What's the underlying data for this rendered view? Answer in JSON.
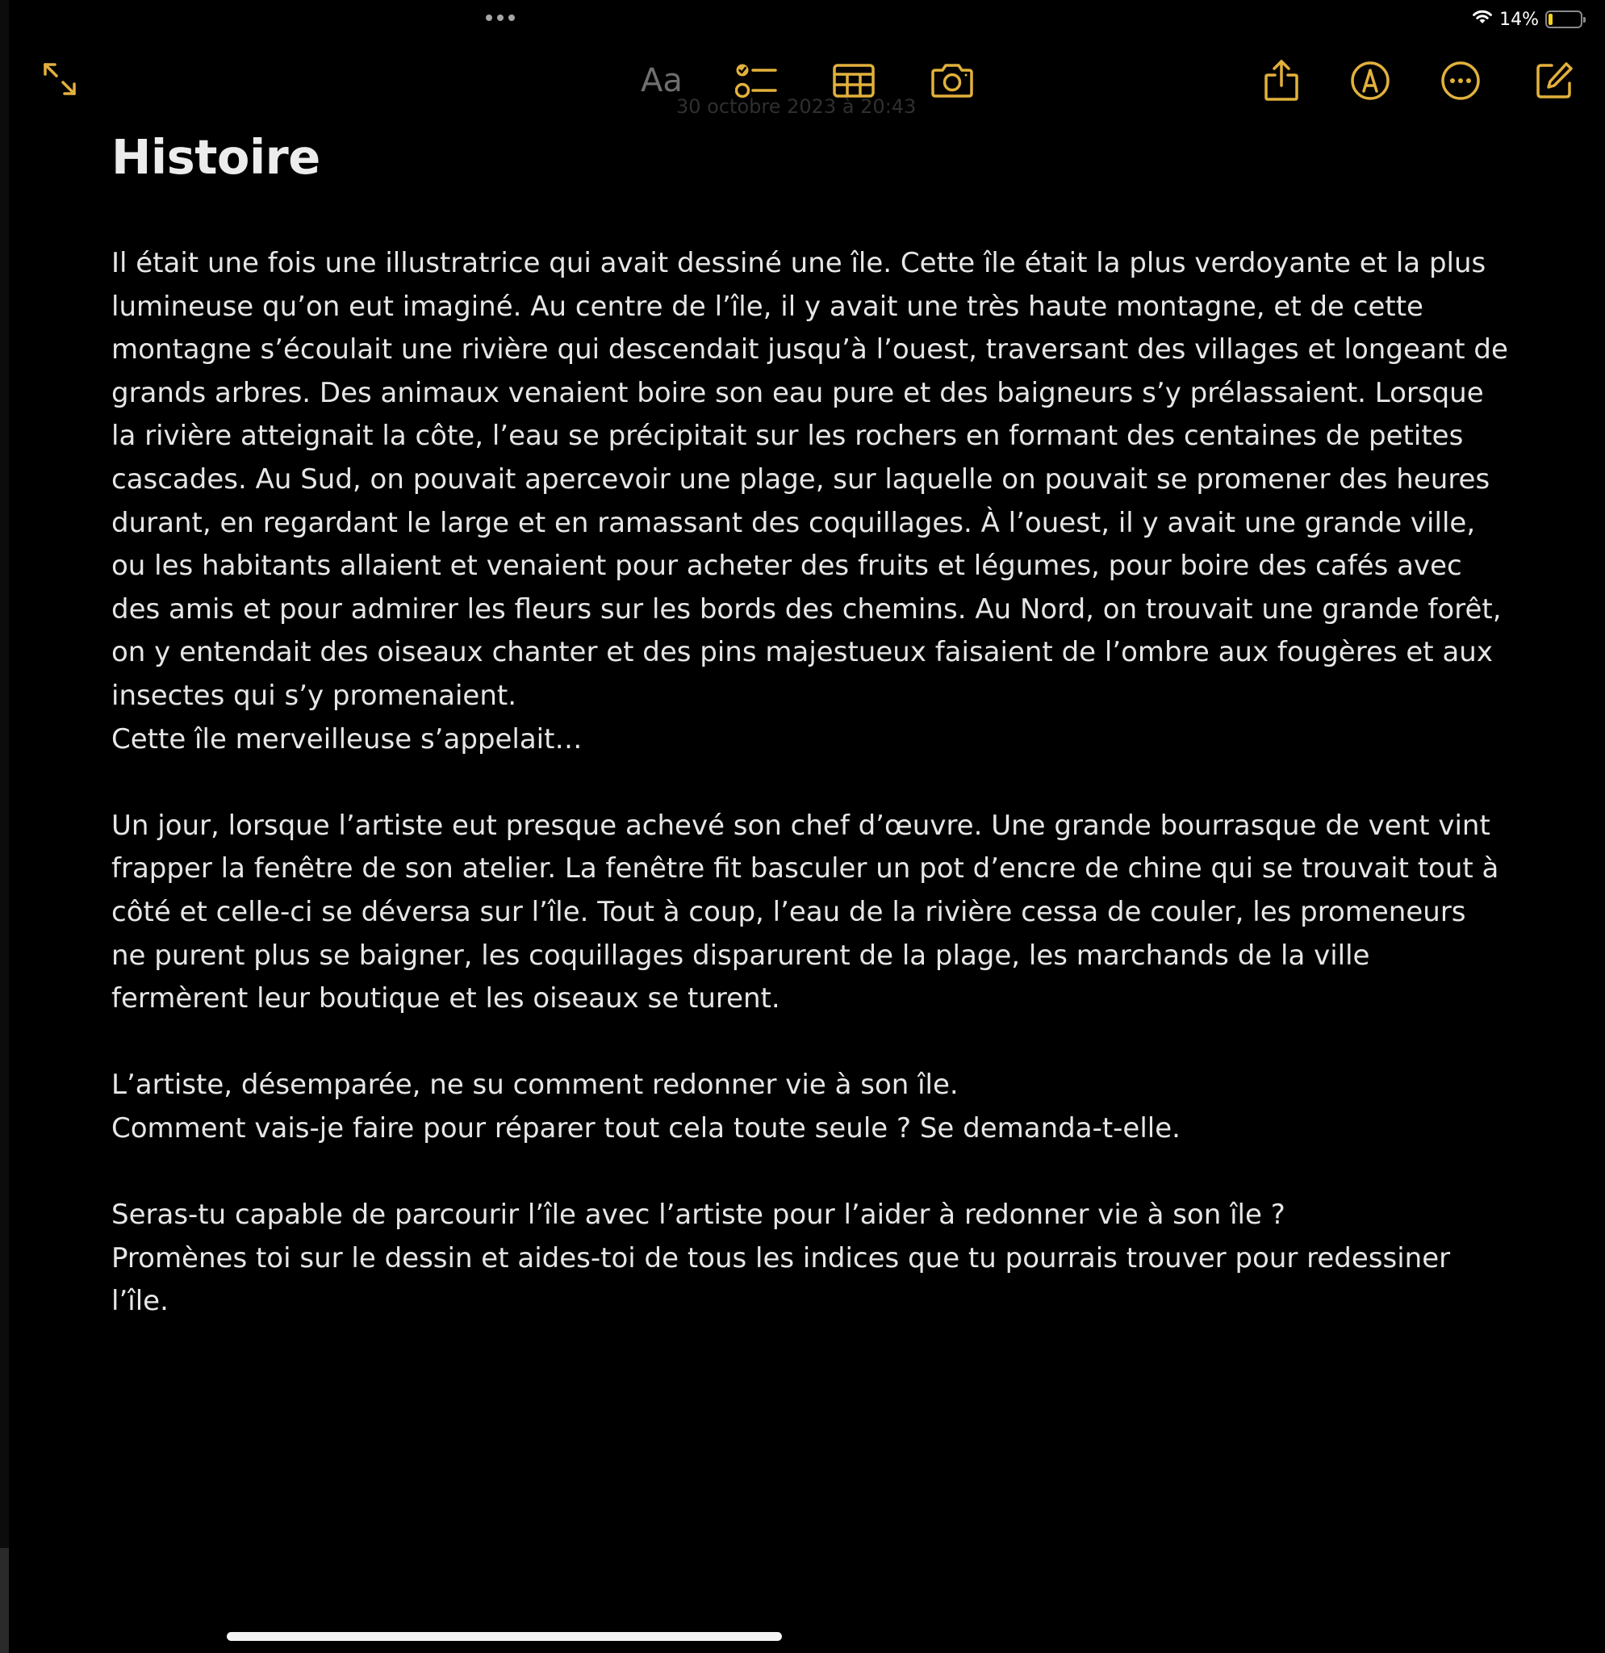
{
  "status_bar": {
    "battery_text": "14%",
    "battery_level": 0.14
  },
  "toolbar": {
    "format_label": "Aa",
    "date_text": "30 octobre 2023 à 20:43"
  },
  "note": {
    "title": "Histoire",
    "lines": [
      "Il était une fois une illustratrice qui avait dessiné une île. Cette île était la plus verdoyante et la plus",
      "lumineuse qu’on eut imaginé. Au centre de l’île, il y avait une très haute montagne, et de cette",
      "montagne s’écoulait une rivière qui descendait jusqu’à l’ouest, traversant des villages et longeant de",
      "grands arbres. Des animaux venaient boire son eau pure et des baigneurs s’y prélassaient. Lorsque",
      "la rivière atteignait la côte, l’eau se précipitait sur les rochers en formant des centaines de petites",
      "cascades. Au Sud, on pouvait apercevoir une plage, sur laquelle on pouvait se promener des heures",
      "durant, en regardant le large et en ramassant des coquillages. À l’ouest, il y avait une grande ville,",
      "ou les habitants allaient et venaient pour acheter des fruits et légumes, pour boire des cafés avec",
      "des amis et pour admirer les fleurs sur les bords des chemins. Au Nord, on trouvait une grande forêt,",
      "on y entendait des oiseaux chanter et des pins majestueux faisaient de l’ombre aux fougères et aux",
      "insectes qui s’y promenaient.",
      "Cette île merveilleuse s’appelait…",
      "",
      "Un jour, lorsque l’artiste eut presque achevé son chef d’œuvre. Une grande bourrasque de vent vint",
      "frapper la fenêtre de son atelier. La fenêtre fit basculer un pot d’encre de chine qui se trouvait tout à",
      "côté et celle-ci se déversa sur l’île. Tout à coup, l’eau de la rivière cessa de couler, les promeneurs",
      "ne purent plus se baigner, les coquillages disparurent de la plage, les marchands de la ville",
      "fermèrent leur boutique et les oiseaux se turent.",
      "",
      "L’artiste, désemparée, ne su comment redonner vie à son île.",
      "Comment vais-je faire pour réparer tout cela toute seule ? Se demanda-t-elle.",
      "",
      "Seras-tu  capable de parcourir l’île avec l’artiste pour l’aider à redonner vie à son île ?",
      "Promènes toi sur le dessin et aides-toi de tous les indices que tu pourrais trouver pour redessiner",
      "l’île."
    ]
  },
  "colors": {
    "accent": "#e2b13c",
    "background": "#000000",
    "text": "#e6e6e6"
  },
  "icons": {
    "collapse": "expand-arrows-icon",
    "checklist": "checklist-icon",
    "table": "table-icon",
    "camera": "camera-icon",
    "share": "share-icon",
    "markup": "markup-pen-icon",
    "more": "more-ellipsis-icon",
    "compose": "compose-icon"
  }
}
